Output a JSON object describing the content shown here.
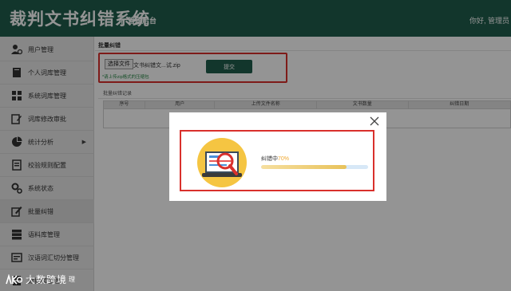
{
  "header": {
    "title": "裁判文书纠错系统",
    "subtitle": "管理后台",
    "greeting": "你好, 管理员"
  },
  "sidebar": {
    "items": [
      {
        "label": "用户管理",
        "icon": "user-gear-icon"
      },
      {
        "label": "个人词库管理",
        "icon": "book-icon"
      },
      {
        "label": "系统词库管理",
        "icon": "database-icon"
      },
      {
        "label": "词库修改审批",
        "icon": "edit-document-icon"
      },
      {
        "label": "统计分析",
        "icon": "pie-chart-icon",
        "has_submenu": true
      },
      {
        "label": "校验规则配置",
        "icon": "checklist-icon"
      },
      {
        "label": "系统状态",
        "icon": "gears-icon"
      },
      {
        "label": "批量纠错",
        "icon": "pen-paper-icon",
        "active": true
      },
      {
        "label": "语料库管理",
        "icon": "stack-icon"
      },
      {
        "label": "汉语词汇切分管理",
        "icon": "split-icon"
      },
      {
        "label": "数据库管理",
        "icon": "server-icon"
      }
    ],
    "arrow_glyph": "▶"
  },
  "upload": {
    "section_title": "批量纠错",
    "choose_button": "选择文件",
    "file_name": "文书纠错文...试.zip",
    "hint": "*请上传zip格式的压缩包",
    "submit_button": "提交"
  },
  "records": {
    "title": "批量纠错记录",
    "columns": [
      "序号",
      "用户",
      "上传文件名称",
      "文书数量",
      "纠错日期"
    ]
  },
  "dialog": {
    "close_glyph": "✕",
    "progress_label": "纠错中",
    "progress_percent_text": "70%",
    "progress_value": 0.8
  },
  "watermark": {
    "text": "大数跨境",
    "tail": "理"
  },
  "colors": {
    "header_bg": "#1f5d4c",
    "accent_red": "#d9302c",
    "progress_fill": "#e8c25a",
    "progress_track": "#d7e8f7"
  }
}
